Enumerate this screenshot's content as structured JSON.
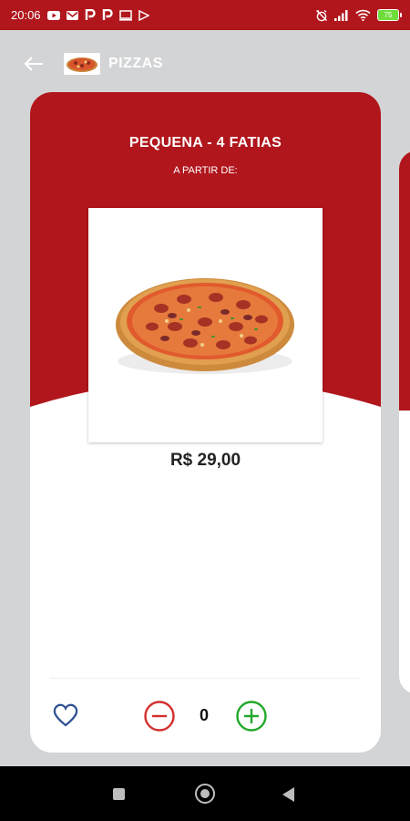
{
  "status_bar": {
    "time": "20:06",
    "notification_icons": [
      "youtube-icon",
      "gmail-icon",
      "p-app-icon",
      "p-app-icon",
      "screen-icon",
      "play-icon"
    ],
    "battery": "75"
  },
  "header": {
    "title": "PIZZAS",
    "back_icon": "arrow-left-icon"
  },
  "product": {
    "title": "PEQUENA - 4 FATIAS",
    "subtitle": "A PARTIR DE:",
    "price": "R$ 29,00",
    "quantity": "0"
  },
  "colors": {
    "brand_red": "#b0161c",
    "favorite_blue": "#2d4f8f",
    "minus_red": "#d32f2f",
    "plus_green": "#22a82a"
  }
}
